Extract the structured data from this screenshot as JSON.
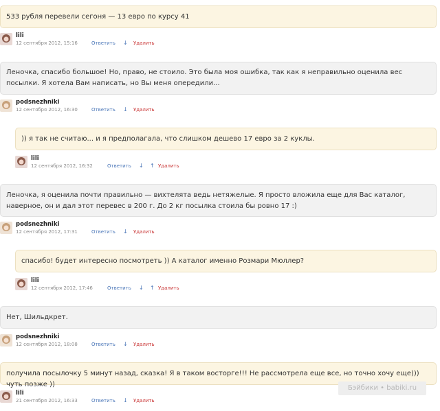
{
  "comments": [
    {
      "text": "533 рубля перевели сегоня — 13 евро по курсу 41",
      "author": "lili",
      "date": "12 сентября 2012, 15:16",
      "reply": "Ответить",
      "delete": "Удалить",
      "up": false
    },
    {
      "text": "Леночка, спасибо большое! Но, право, не стоило. Это была моя ошибка, так как я неправильно оценила вес посылки. Я хотела Вам написать, но Вы меня опередили...",
      "author": "podsnezhniki",
      "date": "12 сентября 2012, 16:30",
      "reply": "Ответить",
      "delete": "Удалить",
      "up": false
    },
    {
      "text": ")) я так не считаю... и я предполагала, что слишком дешево 17 евро за 2 куклы.",
      "author": "lili",
      "date": "12 сентября 2012, 16:32",
      "reply": "Ответить",
      "delete": "Удалить",
      "up": true
    },
    {
      "text": "Леночка, я оценила почти правильно — вихтелята ведь нетяжелые. Я просто вложила еще для Вас каталог, наверное, он и дал этот перевес в 200 г. До 2 кг посылка стоила бы ровно 17 :)",
      "author": "podsnezhniki",
      "date": "12 сентября 2012, 17:31",
      "reply": "Ответить",
      "delete": "Удалить",
      "up": false
    },
    {
      "text": "спасибо! будет интересно посмотреть )) А каталог именно Розмари Мюллер?",
      "author": "lili",
      "date": "12 сентября 2012, 17:46",
      "reply": "Ответить",
      "delete": "Удалить",
      "up": true
    },
    {
      "text": "Нет, Шильдкрет.",
      "author": "podsnezhniki",
      "date": "12 сентября 2012, 18:08",
      "reply": "Ответить",
      "delete": "Удалить",
      "up": false
    },
    {
      "text": "получила посылочку 5 минут назад, сказка! Я в таком восторге!!! Не рассмотрела еще все, но точно хочу еще))) чуть позже ))",
      "author": "lili",
      "date": "21 сентября 2012, 16:33",
      "reply": "Ответить",
      "delete": "Удалить",
      "up": false
    }
  ],
  "icons": {
    "down": "arrow-down-icon",
    "up": "arrow-up-icon"
  },
  "colors": {
    "link": "#4a76b8",
    "delete": "#c83232",
    "yellow_bubble": "#fcf5e2",
    "grey_bubble": "#f2f2f2"
  },
  "watermark": "Бэйбики • babiki.ru"
}
